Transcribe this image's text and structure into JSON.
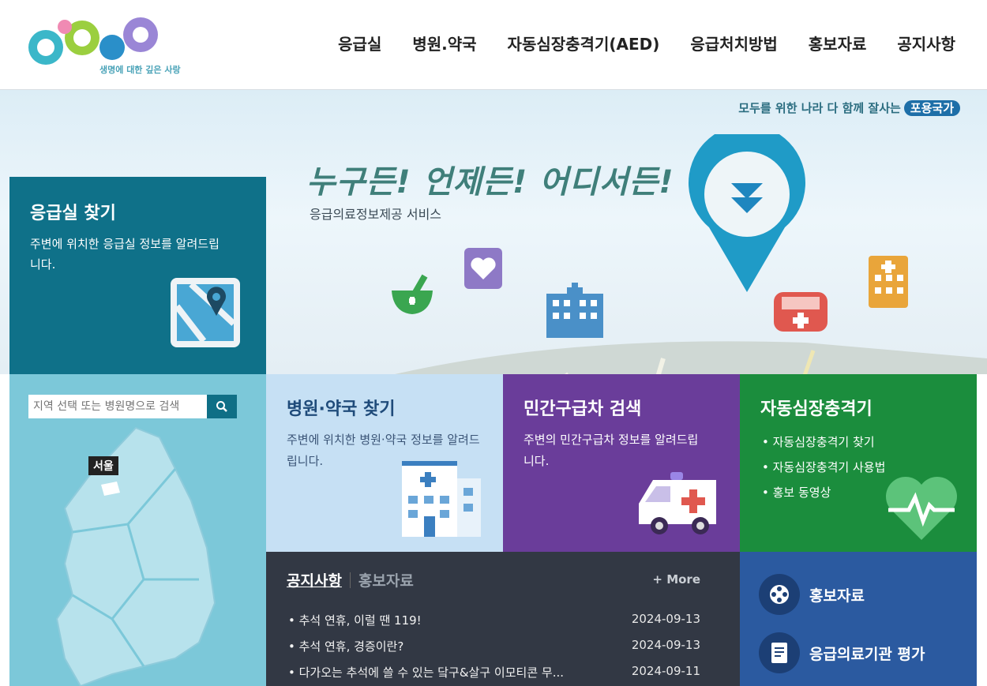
{
  "header": {
    "logo_alt": "E-Gen",
    "logo_tagline": "생명에 대한 깊은 사랑",
    "nav": [
      "응급실",
      "병원.약국",
      "자동심장충격기(AED)",
      "응급처치방법",
      "홍보자료",
      "공지사항"
    ]
  },
  "hero": {
    "slogan": "모두를 위한 나라 다 함께 잘사는",
    "slogan_badge": "포용국가",
    "title": "누구든! 언제든! 어디서든!",
    "subtitle": "응급의료정보제공 서비스"
  },
  "er_panel": {
    "title": "응급실 찾기",
    "desc": "주변에 위치한 응급실 정보를 알려드립니다."
  },
  "map_panel": {
    "search_placeholder": "지역 선택 또는 병원명으로 검색",
    "region_label": "서울"
  },
  "tiles": {
    "hospital": {
      "title": "병원·약국 찾기",
      "desc": "주변에 위치한 병원·약국 정보를 알려드립니다."
    },
    "ambulance": {
      "title": "민간구급차 검색",
      "desc": "주변의 민간구급차 정보를 알려드립니다."
    },
    "aed": {
      "title": "자동심장충격기",
      "items": [
        "• 자동심장충격기 찾기",
        "• 자동심장충격기 사용법",
        "• 홍보 동영상"
      ]
    }
  },
  "notice": {
    "tab_active": "공지사항",
    "tab_inactive": "홍보자료",
    "more": "+ More",
    "items": [
      {
        "title": "• 추석 연휴, 이럴 땐 119!",
        "date": "2024-09-13"
      },
      {
        "title": "• 추석 연휴, 경증이란?",
        "date": "2024-09-13"
      },
      {
        "title": "• 다가오는 추석에 쓸 수 있는 닼구&살구 이모티콘 무...",
        "date": "2024-09-11"
      }
    ]
  },
  "quick_links": {
    "promo": "홍보자료",
    "evaluation": "응급의료기관 평가"
  },
  "colors": {
    "er_teal": "#0f7189",
    "hospital_blue": "#c6e0f4",
    "ambulance_purple": "#6a3d9a",
    "aed_green": "#1b8d3d",
    "notice_dark": "#323844",
    "quick_blue": "#2b5aa0"
  }
}
